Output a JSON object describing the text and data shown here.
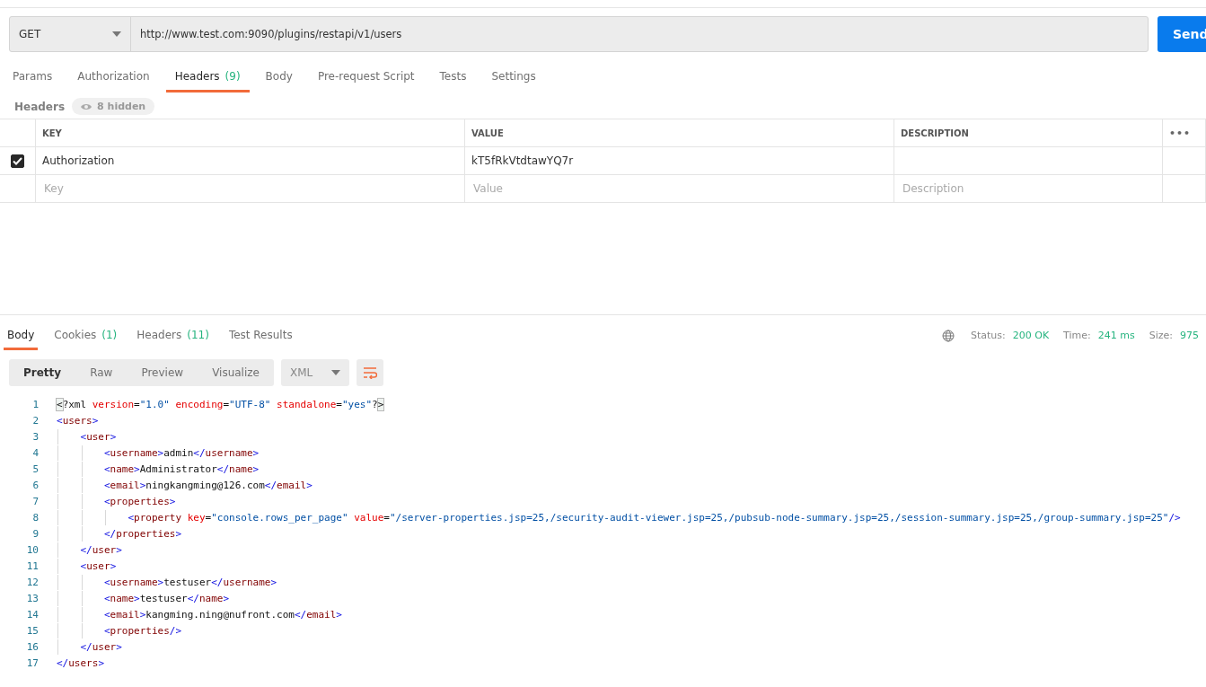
{
  "request": {
    "method": "GET",
    "url": "http://www.test.com:9090/plugins/restapi/v1/users",
    "send_label": "Send"
  },
  "request_tabs": [
    {
      "label": "Params",
      "selected": false
    },
    {
      "label": "Authorization",
      "selected": false
    },
    {
      "label": "Headers",
      "count": "(9)",
      "selected": true
    },
    {
      "label": "Body",
      "selected": false
    },
    {
      "label": "Pre-request Script",
      "selected": false
    },
    {
      "label": "Tests",
      "selected": false
    },
    {
      "label": "Settings",
      "selected": false
    }
  ],
  "headers_bar": {
    "title": "Headers",
    "hidden_label": "8 hidden"
  },
  "headers_table": {
    "columns": [
      "KEY",
      "VALUE",
      "DESCRIPTION"
    ],
    "more_label": "•••",
    "rows": [
      {
        "checked": true,
        "key": "Authorization",
        "value": "kT5fRkVtdtawYQ7r"
      }
    ],
    "new_row": {
      "key_placeholder": "Key",
      "value_placeholder": "Value",
      "description_placeholder": "Description"
    }
  },
  "response_tabs": [
    {
      "label": "Body",
      "selected": true
    },
    {
      "label": "Cookies",
      "count": "(1)",
      "selected": false
    },
    {
      "label": "Headers",
      "count": "(11)",
      "selected": false
    },
    {
      "label": "Test Results",
      "selected": false
    }
  ],
  "response_meta": [
    {
      "label": "Status:",
      "value": "200 OK"
    },
    {
      "label": "Time:",
      "value": "241 ms"
    },
    {
      "label": "Size:",
      "value": "975"
    }
  ],
  "view_modes": [
    {
      "label": "Pretty",
      "selected": true
    },
    {
      "label": "Raw",
      "selected": false
    },
    {
      "label": "Preview",
      "selected": false
    },
    {
      "label": "Visualize",
      "selected": false
    }
  ],
  "format": "XML",
  "code_lines": [
    {
      "number": "1",
      "tokens": [
        {
          "text": "<",
          "kind": "match"
        },
        {
          "text": "?xml ",
          "kind": "plain"
        },
        {
          "text": "version",
          "kind": "attr"
        },
        {
          "text": "=",
          "kind": "plain"
        },
        {
          "text": "\"1.0\"",
          "kind": "string"
        },
        {
          "text": " encoding",
          "kind": "attr"
        },
        {
          "text": "=",
          "kind": "plain"
        },
        {
          "text": "\"UTF-8\"",
          "kind": "string"
        },
        {
          "text": " standalone",
          "kind": "attr"
        },
        {
          "text": "=",
          "kind": "plain"
        },
        {
          "text": "\"yes\"",
          "kind": "string"
        },
        {
          "text": "?",
          "kind": "plain"
        },
        {
          "text": ">",
          "kind": "match"
        }
      ]
    },
    {
      "number": "2",
      "tokens": [
        {
          "text": "<",
          "kind": "punct"
        },
        {
          "text": "users",
          "kind": "tag"
        },
        {
          "text": ">",
          "kind": "punct"
        }
      ]
    },
    {
      "number": "3",
      "tokens": [
        {
          "text": "    <",
          "kind": "punct"
        },
        {
          "text": "user",
          "kind": "tag"
        },
        {
          "text": ">",
          "kind": "punct"
        }
      ]
    },
    {
      "number": "4",
      "tokens": [
        {
          "text": "        <",
          "kind": "punct"
        },
        {
          "text": "username",
          "kind": "tag"
        },
        {
          "text": ">",
          "kind": "punct"
        },
        {
          "text": "admin",
          "kind": "plain"
        },
        {
          "text": "</",
          "kind": "punct"
        },
        {
          "text": "username",
          "kind": "tag"
        },
        {
          "text": ">",
          "kind": "punct"
        }
      ]
    },
    {
      "number": "5",
      "tokens": [
        {
          "text": "        <",
          "kind": "punct"
        },
        {
          "text": "name",
          "kind": "tag"
        },
        {
          "text": ">",
          "kind": "punct"
        },
        {
          "text": "Administrator",
          "kind": "plain"
        },
        {
          "text": "</",
          "kind": "punct"
        },
        {
          "text": "name",
          "kind": "tag"
        },
        {
          "text": ">",
          "kind": "punct"
        }
      ]
    },
    {
      "number": "6",
      "tokens": [
        {
          "text": "        <",
          "kind": "punct"
        },
        {
          "text": "email",
          "kind": "tag"
        },
        {
          "text": ">",
          "kind": "punct"
        },
        {
          "text": "ningkangming@126.com",
          "kind": "plain"
        },
        {
          "text": "</",
          "kind": "punct"
        },
        {
          "text": "email",
          "kind": "tag"
        },
        {
          "text": ">",
          "kind": "punct"
        }
      ]
    },
    {
      "number": "7",
      "tokens": [
        {
          "text": "        <",
          "kind": "punct"
        },
        {
          "text": "properties",
          "kind": "tag"
        },
        {
          "text": ">",
          "kind": "punct"
        }
      ]
    },
    {
      "number": "8",
      "tokens": [
        {
          "text": "            <",
          "kind": "punct"
        },
        {
          "text": "property",
          "kind": "tag"
        },
        {
          "text": " key",
          "kind": "attr"
        },
        {
          "text": "=",
          "kind": "plain"
        },
        {
          "text": "\"console.rows_per_page\"",
          "kind": "string"
        },
        {
          "text": " value",
          "kind": "attr"
        },
        {
          "text": "=",
          "kind": "plain"
        },
        {
          "text": "\"/server-properties.jsp=25,/security-audit-viewer.jsp=25,/pubsub-node-summary.jsp=25,/session-summary.jsp=25,/group-summary.jsp=25\"",
          "kind": "string"
        },
        {
          "text": "/>",
          "kind": "punct"
        }
      ]
    },
    {
      "number": "9",
      "tokens": [
        {
          "text": "        </",
          "kind": "punct"
        },
        {
          "text": "properties",
          "kind": "tag"
        },
        {
          "text": ">",
          "kind": "punct"
        }
      ]
    },
    {
      "number": "10",
      "tokens": [
        {
          "text": "    </",
          "kind": "punct"
        },
        {
          "text": "user",
          "kind": "tag"
        },
        {
          "text": ">",
          "kind": "punct"
        }
      ]
    },
    {
      "number": "11",
      "tokens": [
        {
          "text": "    <",
          "kind": "punct"
        },
        {
          "text": "user",
          "kind": "tag"
        },
        {
          "text": ">",
          "kind": "punct"
        }
      ]
    },
    {
      "number": "12",
      "tokens": [
        {
          "text": "        <",
          "kind": "punct"
        },
        {
          "text": "username",
          "kind": "tag"
        },
        {
          "text": ">",
          "kind": "punct"
        },
        {
          "text": "testuser",
          "kind": "plain"
        },
        {
          "text": "</",
          "kind": "punct"
        },
        {
          "text": "username",
          "kind": "tag"
        },
        {
          "text": ">",
          "kind": "punct"
        }
      ]
    },
    {
      "number": "13",
      "tokens": [
        {
          "text": "        <",
          "kind": "punct"
        },
        {
          "text": "name",
          "kind": "tag"
        },
        {
          "text": ">",
          "kind": "punct"
        },
        {
          "text": "testuser",
          "kind": "plain"
        },
        {
          "text": "</",
          "kind": "punct"
        },
        {
          "text": "name",
          "kind": "tag"
        },
        {
          "text": ">",
          "kind": "punct"
        }
      ]
    },
    {
      "number": "14",
      "tokens": [
        {
          "text": "        <",
          "kind": "punct"
        },
        {
          "text": "email",
          "kind": "tag"
        },
        {
          "text": ">",
          "kind": "punct"
        },
        {
          "text": "kangming.ning@nufront.com",
          "kind": "plain"
        },
        {
          "text": "</",
          "kind": "punct"
        },
        {
          "text": "email",
          "kind": "tag"
        },
        {
          "text": ">",
          "kind": "punct"
        }
      ]
    },
    {
      "number": "15",
      "tokens": [
        {
          "text": "        <",
          "kind": "punct"
        },
        {
          "text": "properties",
          "kind": "tag"
        },
        {
          "text": "/>",
          "kind": "punct"
        }
      ]
    },
    {
      "number": "16",
      "tokens": [
        {
          "text": "    </",
          "kind": "punct"
        },
        {
          "text": "user",
          "kind": "tag"
        },
        {
          "text": ">",
          "kind": "punct"
        }
      ]
    },
    {
      "number": "17",
      "tokens": [
        {
          "text": "</",
          "kind": "punct"
        },
        {
          "text": "users",
          "kind": "tag"
        },
        {
          "text": ">",
          "kind": "punct"
        }
      ]
    }
  ]
}
